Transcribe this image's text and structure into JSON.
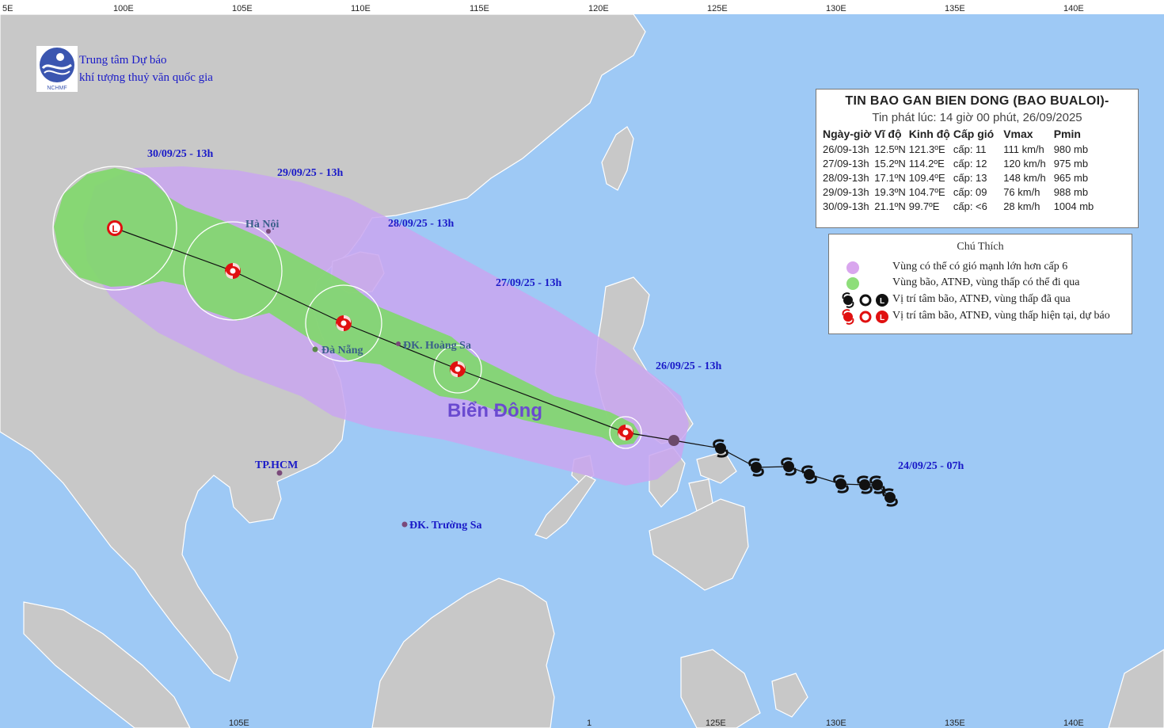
{
  "header": {
    "org_line1": "Trung tâm Dự báo",
    "org_line2": "khí tượng thuỷ văn quốc gia",
    "logo_text": "NCHMF"
  },
  "axis": {
    "top_labels": [
      "100E",
      "105E",
      "110E",
      "115E",
      "120E",
      "125E",
      "130E",
      "135E",
      "140E"
    ],
    "bottom_labels": [
      "105E",
      "125E",
      "130E",
      "135E",
      "140E"
    ],
    "edge_label": "5E",
    "bottom_partial": "1"
  },
  "bulletin": {
    "title": "TIN BAO GAN BIEN DONG (BAO BUALOI)-",
    "issued": "Tin phát lúc: 14 giờ 00 phút, 26/09/2025",
    "columns": [
      "Ngày-giờ",
      "Vĩ độ",
      "Kinh độ",
      "Cấp gió",
      "Vmax",
      "Pmin"
    ],
    "rows": [
      [
        "26/09-13h",
        "12.5ºN",
        "121.3ºE",
        "cấp: 11",
        "111 km/h",
        "980 mb"
      ],
      [
        "27/09-13h",
        "15.2ºN",
        "114.2ºE",
        "cấp: 12",
        "120 km/h",
        "975 mb"
      ],
      [
        "28/09-13h",
        "17.1ºN",
        "109.4ºE",
        "cấp: 13",
        "148 km/h",
        "965 mb"
      ],
      [
        "29/09-13h",
        "19.3ºN",
        "104.7ºE",
        "cấp: 09",
        "76 km/h",
        "988 mb"
      ],
      [
        "30/09-13h",
        "21.1ºN",
        "99.7ºE",
        "cấp: <6",
        "28 km/h",
        "1004 mb"
      ]
    ]
  },
  "legend": {
    "title": "Chú Thích",
    "items": [
      "Vùng có thể có gió mạnh lớn hơn cấp 6",
      "Vùng bão, ATNĐ, vùng thấp có thể đi qua",
      "Vị trí tâm bão, ATNĐ, vùng thấp đã qua",
      "Vị trí tâm bão, ATNĐ, vùng thấp hiện tại, dự báo"
    ]
  },
  "labels": {
    "d30": "30/09/25 - 13h",
    "d29": "29/09/25 - 13h",
    "d28": "28/09/25 - 13h",
    "d27": "27/09/25 - 13h",
    "d26": "26/09/25 - 13h",
    "d24": "24/09/25 - 07h",
    "sea": "Biển Đông"
  },
  "cities": {
    "hanoi": "Hà Nội",
    "danang": "Đà Nẵng",
    "hoangsa": "ĐK. Hoàng Sa",
    "hcm": "TP.HCM",
    "truongsa": "ĐK. Trường Sa"
  },
  "colors": {
    "sea": "#9ec9f5",
    "land": "#c8c8c8",
    "risk_zone": "#c9a6f0",
    "risk_zone_land": "#e3b2e6",
    "storm_zone": "#7fd86a",
    "current_marker": "#e01010",
    "past_marker": "#111111",
    "label_blue": "#1a1ac8"
  }
}
